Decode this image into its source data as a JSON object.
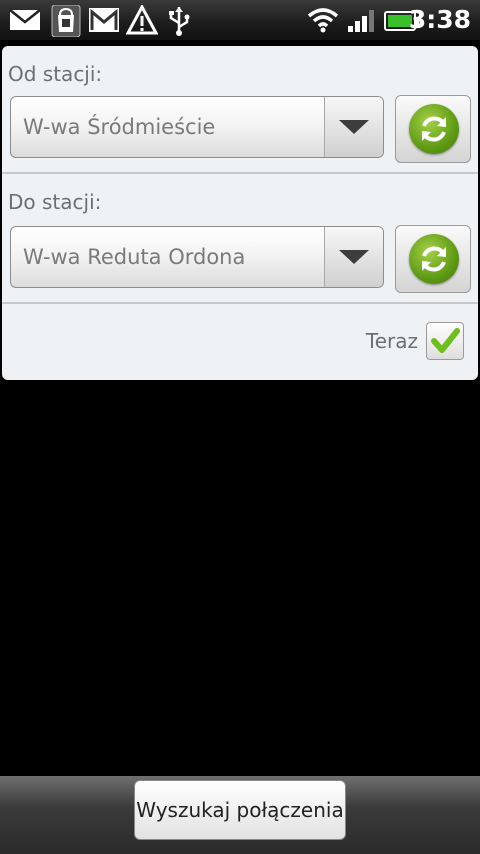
{
  "status_bar": {
    "time": "3:38",
    "icons": [
      "mail-icon",
      "shopping-bag-icon",
      "gmail-icon",
      "warning-icon",
      "usb-icon",
      "wifi-icon",
      "signal-icon",
      "battery-icon"
    ]
  },
  "from_station": {
    "label": "Od stacji:",
    "value": "W-wa Śródmieście"
  },
  "to_station": {
    "label": "Do stacji:",
    "value": "W-wa Reduta Ordona"
  },
  "now_option": {
    "label": "Teraz",
    "checked": true
  },
  "search_button": {
    "label": "Wyszukaj połączenia"
  },
  "colors": {
    "accent_green": "#5f9b14",
    "panel_bg": "#eef2f5",
    "check_green": "#6cbf1c"
  }
}
